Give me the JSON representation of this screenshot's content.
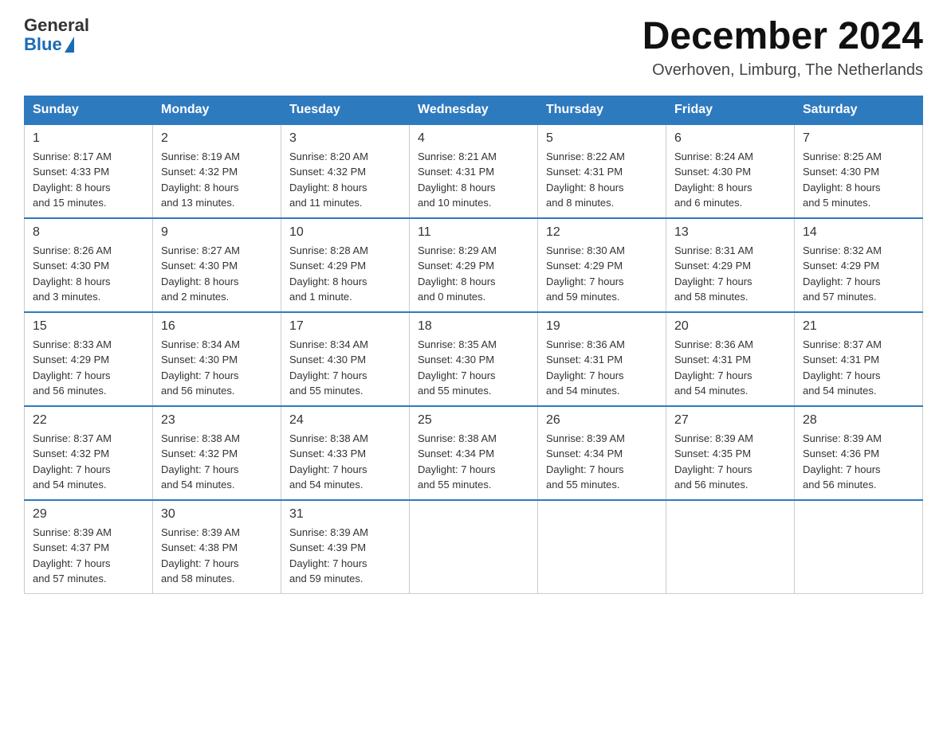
{
  "header": {
    "logo_general": "General",
    "logo_blue": "Blue",
    "month_year": "December 2024",
    "location": "Overhoven, Limburg, The Netherlands"
  },
  "days_of_week": [
    "Sunday",
    "Monday",
    "Tuesday",
    "Wednesday",
    "Thursday",
    "Friday",
    "Saturday"
  ],
  "weeks": [
    [
      {
        "day": "1",
        "info": "Sunrise: 8:17 AM\nSunset: 4:33 PM\nDaylight: 8 hours\nand 15 minutes."
      },
      {
        "day": "2",
        "info": "Sunrise: 8:19 AM\nSunset: 4:32 PM\nDaylight: 8 hours\nand 13 minutes."
      },
      {
        "day": "3",
        "info": "Sunrise: 8:20 AM\nSunset: 4:32 PM\nDaylight: 8 hours\nand 11 minutes."
      },
      {
        "day": "4",
        "info": "Sunrise: 8:21 AM\nSunset: 4:31 PM\nDaylight: 8 hours\nand 10 minutes."
      },
      {
        "day": "5",
        "info": "Sunrise: 8:22 AM\nSunset: 4:31 PM\nDaylight: 8 hours\nand 8 minutes."
      },
      {
        "day": "6",
        "info": "Sunrise: 8:24 AM\nSunset: 4:30 PM\nDaylight: 8 hours\nand 6 minutes."
      },
      {
        "day": "7",
        "info": "Sunrise: 8:25 AM\nSunset: 4:30 PM\nDaylight: 8 hours\nand 5 minutes."
      }
    ],
    [
      {
        "day": "8",
        "info": "Sunrise: 8:26 AM\nSunset: 4:30 PM\nDaylight: 8 hours\nand 3 minutes."
      },
      {
        "day": "9",
        "info": "Sunrise: 8:27 AM\nSunset: 4:30 PM\nDaylight: 8 hours\nand 2 minutes."
      },
      {
        "day": "10",
        "info": "Sunrise: 8:28 AM\nSunset: 4:29 PM\nDaylight: 8 hours\nand 1 minute."
      },
      {
        "day": "11",
        "info": "Sunrise: 8:29 AM\nSunset: 4:29 PM\nDaylight: 8 hours\nand 0 minutes."
      },
      {
        "day": "12",
        "info": "Sunrise: 8:30 AM\nSunset: 4:29 PM\nDaylight: 7 hours\nand 59 minutes."
      },
      {
        "day": "13",
        "info": "Sunrise: 8:31 AM\nSunset: 4:29 PM\nDaylight: 7 hours\nand 58 minutes."
      },
      {
        "day": "14",
        "info": "Sunrise: 8:32 AM\nSunset: 4:29 PM\nDaylight: 7 hours\nand 57 minutes."
      }
    ],
    [
      {
        "day": "15",
        "info": "Sunrise: 8:33 AM\nSunset: 4:29 PM\nDaylight: 7 hours\nand 56 minutes."
      },
      {
        "day": "16",
        "info": "Sunrise: 8:34 AM\nSunset: 4:30 PM\nDaylight: 7 hours\nand 56 minutes."
      },
      {
        "day": "17",
        "info": "Sunrise: 8:34 AM\nSunset: 4:30 PM\nDaylight: 7 hours\nand 55 minutes."
      },
      {
        "day": "18",
        "info": "Sunrise: 8:35 AM\nSunset: 4:30 PM\nDaylight: 7 hours\nand 55 minutes."
      },
      {
        "day": "19",
        "info": "Sunrise: 8:36 AM\nSunset: 4:31 PM\nDaylight: 7 hours\nand 54 minutes."
      },
      {
        "day": "20",
        "info": "Sunrise: 8:36 AM\nSunset: 4:31 PM\nDaylight: 7 hours\nand 54 minutes."
      },
      {
        "day": "21",
        "info": "Sunrise: 8:37 AM\nSunset: 4:31 PM\nDaylight: 7 hours\nand 54 minutes."
      }
    ],
    [
      {
        "day": "22",
        "info": "Sunrise: 8:37 AM\nSunset: 4:32 PM\nDaylight: 7 hours\nand 54 minutes."
      },
      {
        "day": "23",
        "info": "Sunrise: 8:38 AM\nSunset: 4:32 PM\nDaylight: 7 hours\nand 54 minutes."
      },
      {
        "day": "24",
        "info": "Sunrise: 8:38 AM\nSunset: 4:33 PM\nDaylight: 7 hours\nand 54 minutes."
      },
      {
        "day": "25",
        "info": "Sunrise: 8:38 AM\nSunset: 4:34 PM\nDaylight: 7 hours\nand 55 minutes."
      },
      {
        "day": "26",
        "info": "Sunrise: 8:39 AM\nSunset: 4:34 PM\nDaylight: 7 hours\nand 55 minutes."
      },
      {
        "day": "27",
        "info": "Sunrise: 8:39 AM\nSunset: 4:35 PM\nDaylight: 7 hours\nand 56 minutes."
      },
      {
        "day": "28",
        "info": "Sunrise: 8:39 AM\nSunset: 4:36 PM\nDaylight: 7 hours\nand 56 minutes."
      }
    ],
    [
      {
        "day": "29",
        "info": "Sunrise: 8:39 AM\nSunset: 4:37 PM\nDaylight: 7 hours\nand 57 minutes."
      },
      {
        "day": "30",
        "info": "Sunrise: 8:39 AM\nSunset: 4:38 PM\nDaylight: 7 hours\nand 58 minutes."
      },
      {
        "day": "31",
        "info": "Sunrise: 8:39 AM\nSunset: 4:39 PM\nDaylight: 7 hours\nand 59 minutes."
      },
      {
        "day": "",
        "info": ""
      },
      {
        "day": "",
        "info": ""
      },
      {
        "day": "",
        "info": ""
      },
      {
        "day": "",
        "info": ""
      }
    ]
  ]
}
